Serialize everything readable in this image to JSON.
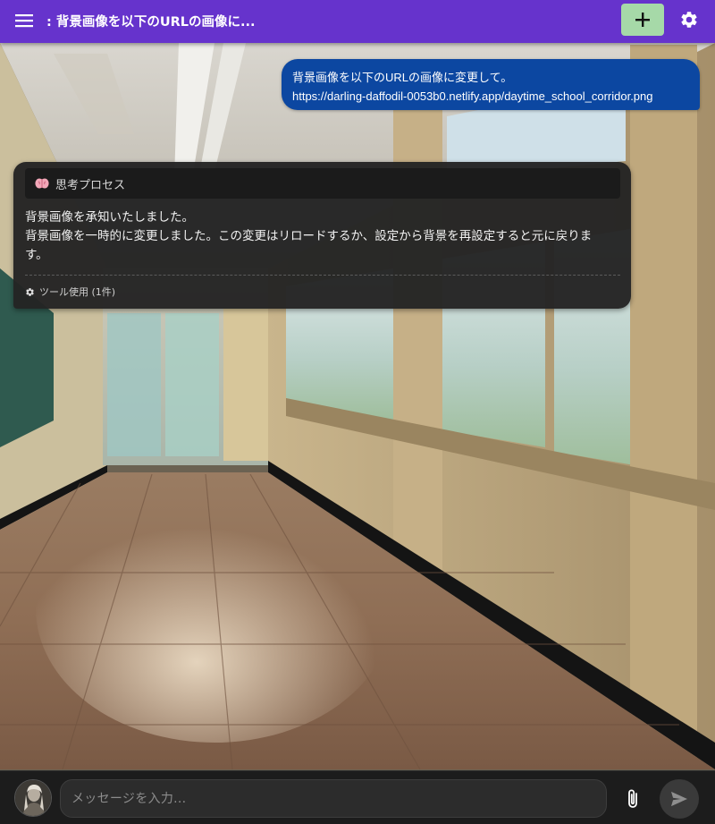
{
  "header": {
    "menu_icon": "hamburger-menu-icon",
    "title": ": 背景画像を以下のURLの画像に...",
    "new_chat_icon": "plus-icon",
    "settings_icon": "gear-icon",
    "color": "#6633cc",
    "new_chat_color": "#a6d9a8"
  },
  "messages": {
    "user": {
      "lines": [
        "背景画像を以下のURLの画像に変更して。",
        "https://darling-daffodil-0053b0.netlify.app/daytime_school_corridor.png"
      ],
      "color": "#0c47a1"
    },
    "assistant": {
      "thinking_icon": "brain-icon",
      "thinking_label": "思考プロセス",
      "lines": [
        "背景画像を承知いたしました。",
        "背景画像を一時的に変更しました。この変更はリロードするか、設定から背景を再設定すると元に戻りま",
        "す。"
      ],
      "tool_icon": "gear-icon",
      "tool_label": "ツール使用 (1件)"
    }
  },
  "input_bar": {
    "placeholder": "メッセージを入力...",
    "value": "",
    "avatar_icon": "avatar",
    "attach_icon": "paperclip-icon",
    "send_icon": "send-icon"
  }
}
